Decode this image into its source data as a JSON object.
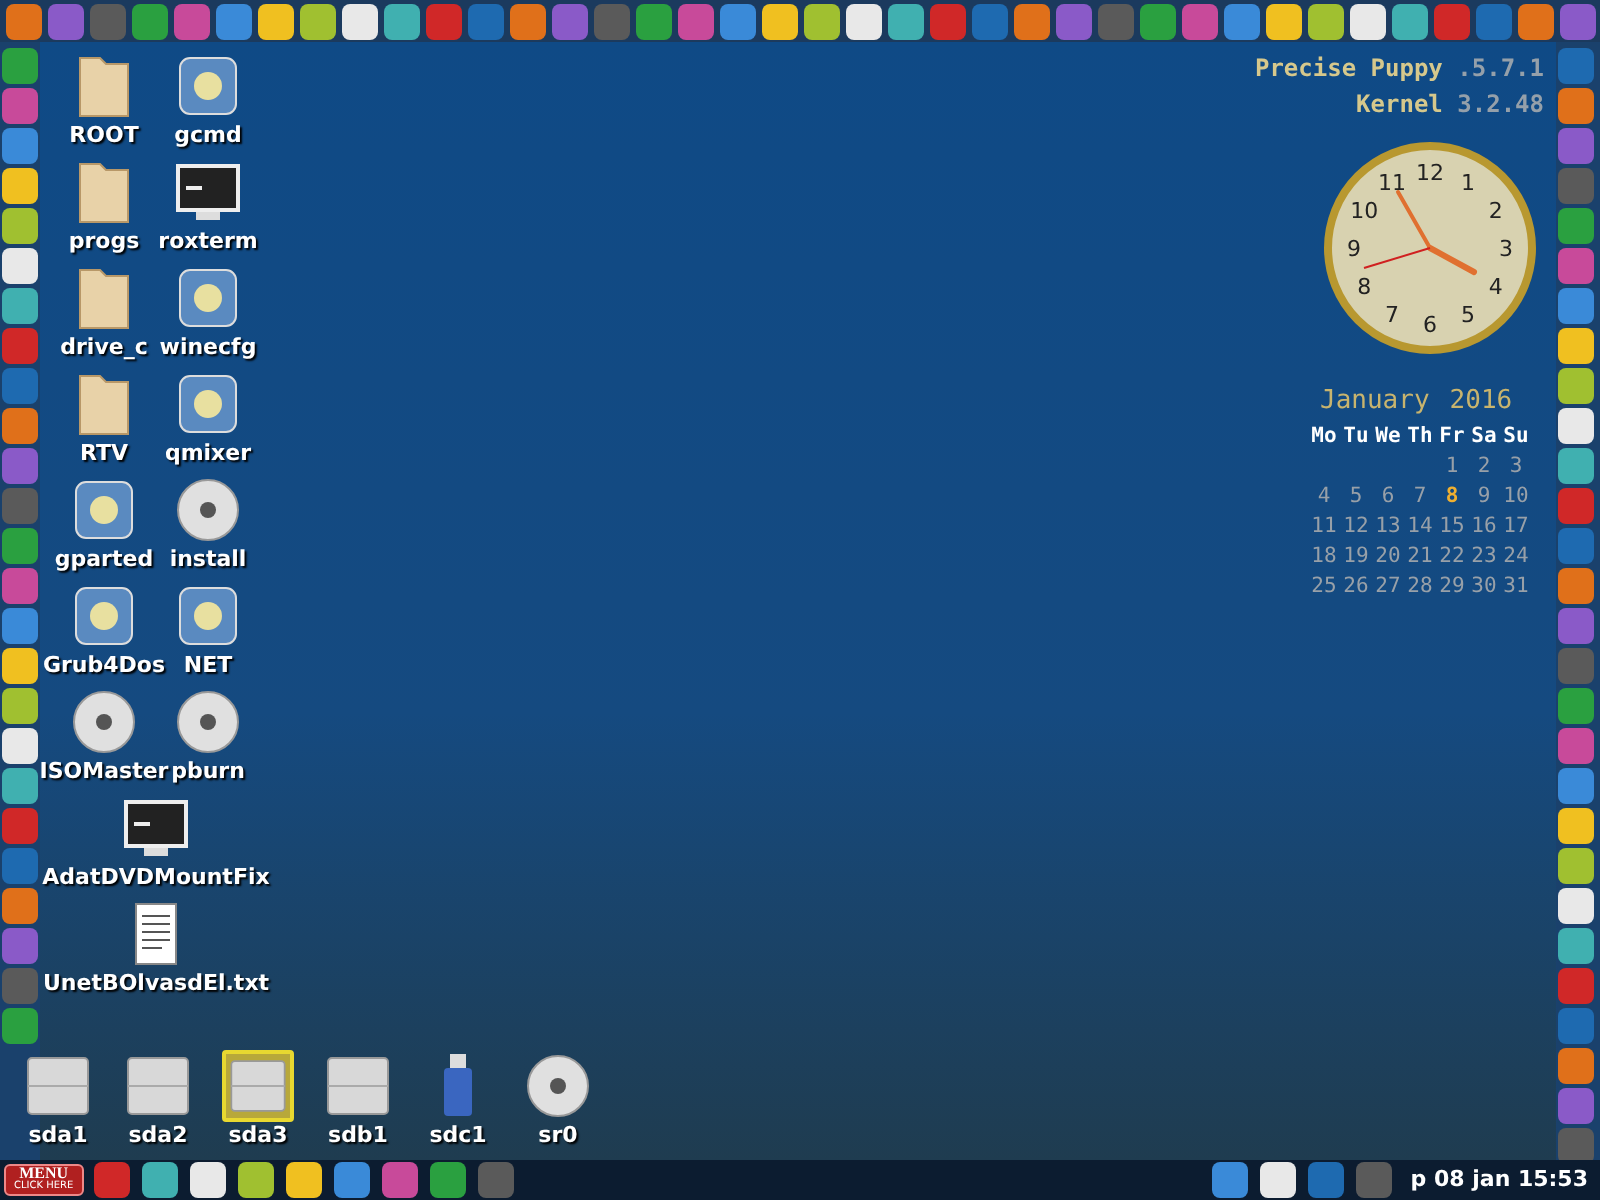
{
  "desktop": {
    "icon_rows": [
      [
        {
          "label": "ROOT",
          "kind": "folder"
        },
        {
          "label": "gcmd",
          "kind": "app"
        }
      ],
      [
        {
          "label": "progs",
          "kind": "folder"
        },
        {
          "label": "roxterm",
          "kind": "terminal"
        }
      ],
      [
        {
          "label": "drive_c",
          "kind": "folder"
        },
        {
          "label": "winecfg",
          "kind": "app"
        }
      ],
      [
        {
          "label": "RTV",
          "kind": "folder"
        },
        {
          "label": "qmixer",
          "kind": "app"
        }
      ],
      [
        {
          "label": "gparted",
          "kind": "app"
        },
        {
          "label": "install",
          "kind": "cd"
        }
      ],
      [
        {
          "label": "Grub4Dos",
          "kind": "app"
        },
        {
          "label": "NET",
          "kind": "app"
        }
      ],
      [
        {
          "label": "ISOMaster",
          "kind": "cd"
        },
        {
          "label": "pburn",
          "kind": "cd"
        }
      ],
      [
        {
          "label": "AdatDVDMountFix",
          "kind": "terminal"
        }
      ],
      [
        {
          "label": "UnetBOlvasdEl.txt",
          "kind": "document"
        }
      ]
    ],
    "drives": [
      {
        "label": "sda1",
        "kind": "disk",
        "selected": false
      },
      {
        "label": "sda2",
        "kind": "disk",
        "selected": false
      },
      {
        "label": "sda3",
        "kind": "disk",
        "selected": true
      },
      {
        "label": "sdb1",
        "kind": "disk",
        "selected": false
      },
      {
        "label": "sdc1",
        "kind": "usb",
        "selected": false
      },
      {
        "label": "sr0",
        "kind": "cd",
        "selected": false
      }
    ]
  },
  "system_info": {
    "distro": "Precise Puppy",
    "version": ".5.7.1",
    "kernel_label": "Kernel",
    "kernel_version": "3.2.48"
  },
  "clock": {
    "numerals": [
      "12",
      "11",
      "1",
      "10",
      "2",
      "9",
      "3",
      "8",
      "4",
      "7",
      "5",
      "6"
    ]
  },
  "calendar": {
    "month": "January",
    "year": "2016",
    "weekdays": [
      "Mo",
      "Tu",
      "We",
      "Th",
      "Fr",
      "Sa",
      "Su"
    ],
    "weeks": [
      [
        {
          "day": "1",
          "selected": false
        },
        {
          "day": "2",
          "selected": false
        },
        {
          "day": "3",
          "selected": false
        }
      ],
      [
        {
          "day": "4",
          "selected": false
        },
        {
          "day": "5",
          "selected": false
        },
        {
          "day": "6",
          "selected": false
        },
        {
          "day": "7",
          "selected": false
        },
        {
          "day": "8",
          "selected": true
        },
        {
          "day": "9",
          "selected": false
        },
        {
          "day": "10",
          "selected": false
        }
      ],
      [
        {
          "day": "11",
          "selected": false
        },
        {
          "day": "12",
          "selected": false
        },
        {
          "day": "13",
          "selected": false
        },
        {
          "day": "14",
          "selected": false
        },
        {
          "day": "15",
          "selected": false
        },
        {
          "day": "16",
          "selected": false
        },
        {
          "day": "17",
          "selected": false
        }
      ],
      [
        {
          "day": "18",
          "selected": false
        },
        {
          "day": "19",
          "selected": false
        },
        {
          "day": "20",
          "selected": false
        },
        {
          "day": "21",
          "selected": false
        },
        {
          "day": "22",
          "selected": false
        },
        {
          "day": "23",
          "selected": false
        },
        {
          "day": "24",
          "selected": false
        }
      ],
      [
        {
          "day": "25",
          "selected": false
        },
        {
          "day": "26",
          "selected": false
        },
        {
          "day": "27",
          "selected": false
        },
        {
          "day": "28",
          "selected": false
        },
        {
          "day": "29",
          "selected": false
        },
        {
          "day": "30",
          "selected": false
        },
        {
          "day": "31",
          "selected": false
        }
      ]
    ]
  },
  "taskbar": {
    "menu_button": {
      "title": "MENU",
      "subtitle": "CLICK HERE"
    },
    "tray_clock": "p 08 jan 15:53"
  }
}
